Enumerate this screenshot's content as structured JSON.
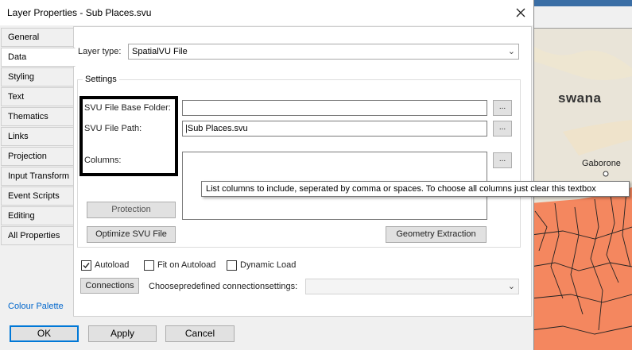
{
  "window": {
    "title": "Layer Properties - Sub Places.svu"
  },
  "tabs": [
    {
      "label": "General"
    },
    {
      "label": "Data"
    },
    {
      "label": "Styling"
    },
    {
      "label": "Text"
    },
    {
      "label": "Thematics"
    },
    {
      "label": "Links"
    },
    {
      "label": "Projection"
    },
    {
      "label": "Input Transform"
    },
    {
      "label": "Event Scripts"
    },
    {
      "label": "Editing"
    },
    {
      "label": "All Properties"
    }
  ],
  "active_tab": "Data",
  "layer_type": {
    "label": "Layer type:",
    "value": "SpatialVU File"
  },
  "settings": {
    "legend": "Settings",
    "base_folder_label": "SVU File Base Folder:",
    "base_folder_value": "",
    "file_path_label": "SVU File Path:",
    "file_path_value": "|Sub Places.svu",
    "columns_label": "Columns:",
    "columns_value": "",
    "browse_label": "...",
    "protection_label": "Protection",
    "optimize_label": "Optimize SVU File",
    "geometry_label": "Geometry Extraction"
  },
  "tooltip": "List columns to include, seperated by comma or spaces. To choose all columns just clear this textbox",
  "options": {
    "autoload_label": "Autoload",
    "autoload_checked": true,
    "fit_on_autoload_label": "Fit on Autoload",
    "fit_on_autoload_checked": false,
    "dynamic_load_label": "Dynamic Load",
    "dynamic_load_checked": false
  },
  "connections": {
    "button_label": "Connections",
    "predefined_label": "Choosepredefined connectionsettings:",
    "predefined_value": ""
  },
  "colour_palette_label": "Colour Palette",
  "buttons": {
    "ok": "OK",
    "apply": "Apply",
    "cancel": "Cancel"
  },
  "map": {
    "label_botswana": "swana",
    "label_gaborone": "Gaborone"
  },
  "colors": {
    "map_fill": "#f4875f",
    "map_bg": "#e9e4d8",
    "accent": "#0078d7",
    "link": "#0066cc"
  }
}
